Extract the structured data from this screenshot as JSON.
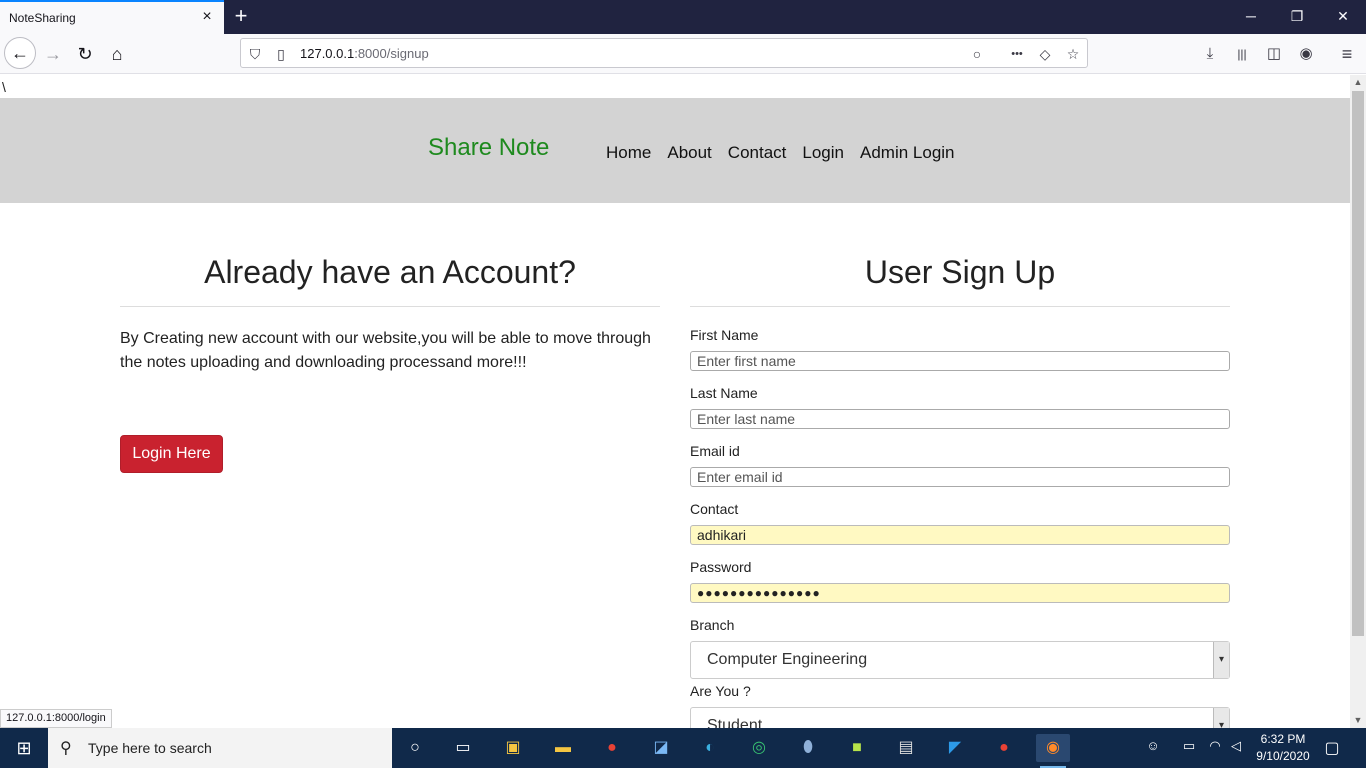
{
  "browser": {
    "tab_title": "NoteSharing",
    "url_host": "127.0.0.1",
    "url_rest": ":8000/signup",
    "status_link": "127.0.0.1:8000/login"
  },
  "page": {
    "stray_text": "\\",
    "brand": "Share Note",
    "nav": [
      "Home",
      "About",
      "Contact",
      "Login",
      "Admin Login"
    ]
  },
  "left": {
    "heading": "Already have an Account?",
    "text": "By Creating new account with our website,you will be able to move through the notes uploading and downloading processand more!!!",
    "button": "Login Here"
  },
  "signup": {
    "heading": "User Sign Up",
    "first_name_label": "First Name",
    "first_name_placeholder": "Enter first name",
    "last_name_label": "Last Name",
    "last_name_placeholder": "Enter last name",
    "email_label": "Email id",
    "email_placeholder": "Enter email id",
    "contact_label": "Contact",
    "contact_value": "adhikari",
    "password_label": "Password",
    "password_value": "●●●●●●●●●●●●●●●",
    "branch_label": "Branch",
    "branch_value": "Computer Engineering",
    "role_label": "Are You ?",
    "role_value": "Student"
  },
  "taskbar": {
    "search_placeholder": "Type here to search",
    "time": "6:32 PM",
    "date": "9/10/2020"
  },
  "icons": {
    "tab_close": "×",
    "new_tab": "+",
    "back": "←",
    "forward": "→",
    "reload": "↻",
    "home": "⌂",
    "shield": "⛉",
    "page": "▯",
    "bulb": "○",
    "more": "•••",
    "pocket": "◇",
    "star": "☆",
    "download": "⤓",
    "library": "|||",
    "sidebar": "◫",
    "account": "◉",
    "menu": "≡",
    "minimize": "─",
    "restore": "❐",
    "close": "✕",
    "windows": "⊞",
    "search": "⚲",
    "chevron": "▾",
    "scroll_up": "▲",
    "scroll_down": "▼"
  }
}
